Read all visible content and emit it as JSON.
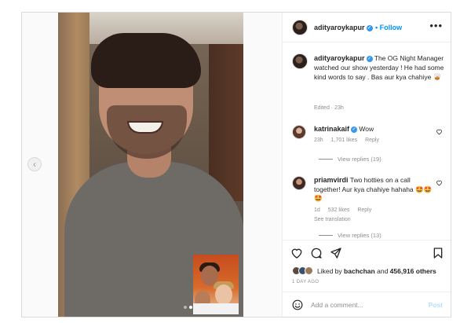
{
  "post": {
    "username": "adityaroykapur",
    "follow_label": "Follow",
    "more_icon": "more-horizontal-icon",
    "caption_text": "The OG Night Manager watched our show yesterday ! He had some kind words to say . Bas aur kya chahiye 🥃",
    "caption_meta": "Edited · 23h"
  },
  "comments": [
    {
      "username": "katrinakaif",
      "text": "Wow",
      "time": "23h",
      "likes": "1,701 likes",
      "reply_label": "Reply",
      "view_replies": "View replies (19)"
    },
    {
      "username": "priamvirdi",
      "text": "Two hotties on a call together! Aur kya chahiye hahaha 🤩🤩🤩",
      "time": "1d",
      "likes": "532 likes",
      "reply_label": "Reply",
      "see_translation": "See translation",
      "view_replies": "View replies (13)"
    }
  ],
  "likes": {
    "prefix": "Liked by",
    "user": "bachchan",
    "conjunction": "and",
    "others": "456,916 others"
  },
  "date": "1 DAY AGO",
  "add_comment": {
    "placeholder": "Add a comment...",
    "post_label": "Post"
  },
  "carousel": {
    "prev_glyph": "‹",
    "dots": 2,
    "active_dot": 2
  },
  "colors": {
    "link_blue": "#0095f6",
    "verified_blue": "#3897f0",
    "muted": "#8e8e8e",
    "post_disabled": "#b2dffc"
  }
}
